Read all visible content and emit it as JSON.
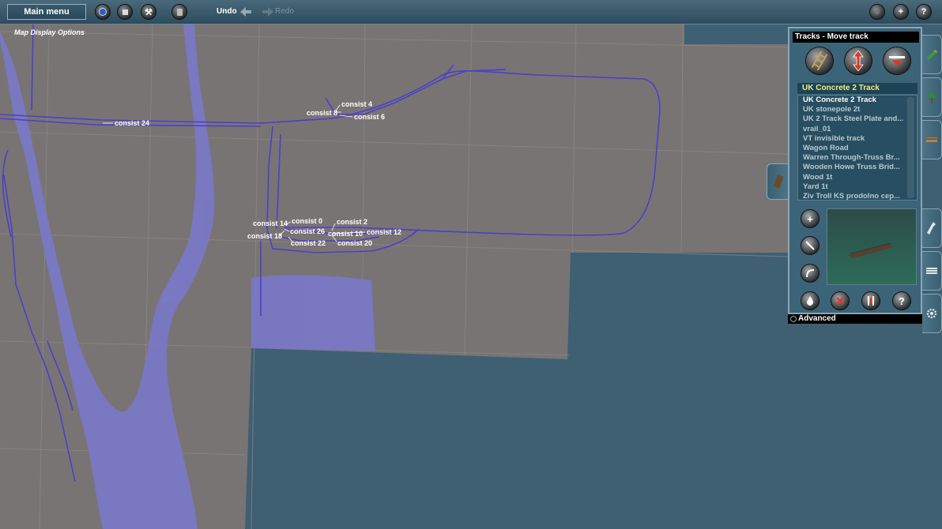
{
  "topbar": {
    "main_menu": "Main menu",
    "undo": "Undo",
    "redo": "Redo",
    "right_plus": "+",
    "right_help": "?"
  },
  "map": {
    "display_options": "Map Display Options",
    "consists": [
      {
        "id": "c24",
        "label": "consist 24"
      },
      {
        "id": "c4",
        "label": "consist 4"
      },
      {
        "id": "c8",
        "label": "consist 8"
      },
      {
        "id": "c6",
        "label": "consist 6"
      },
      {
        "id": "c14",
        "label": "consist 14"
      },
      {
        "id": "c0",
        "label": "consist 0"
      },
      {
        "id": "c2",
        "label": "consist 2"
      },
      {
        "id": "c26",
        "label": "consist 26"
      },
      {
        "id": "c18",
        "label": "consist 18"
      },
      {
        "id": "c10",
        "label": "consist 10"
      },
      {
        "id": "c12",
        "label": "consist 12"
      },
      {
        "id": "c22",
        "label": "consist 22"
      },
      {
        "id": "c20",
        "label": "consist 20"
      }
    ],
    "colors": {
      "water": "#3f5f73",
      "land": "#797474",
      "river": "#7a78c7",
      "track": "#4a40c9"
    }
  },
  "panel": {
    "title": "Tracks - Move track",
    "selected": "UK Concrete 2 Track",
    "items": [
      "UK Concrete 2 Track",
      "UK stonepole 2t",
      "UK 2 Track Steel Plate and...",
      "vrail_01",
      "VT invisible track",
      "Wagon Road",
      "Warren Through-Truss Br...",
      "Wooden Howe Truss Brid...",
      "Wood 1t",
      "Yard 1t",
      "Ziv Troll KS prodolno cep..."
    ],
    "plus": "+",
    "help": "?",
    "advanced": "Advanced"
  }
}
